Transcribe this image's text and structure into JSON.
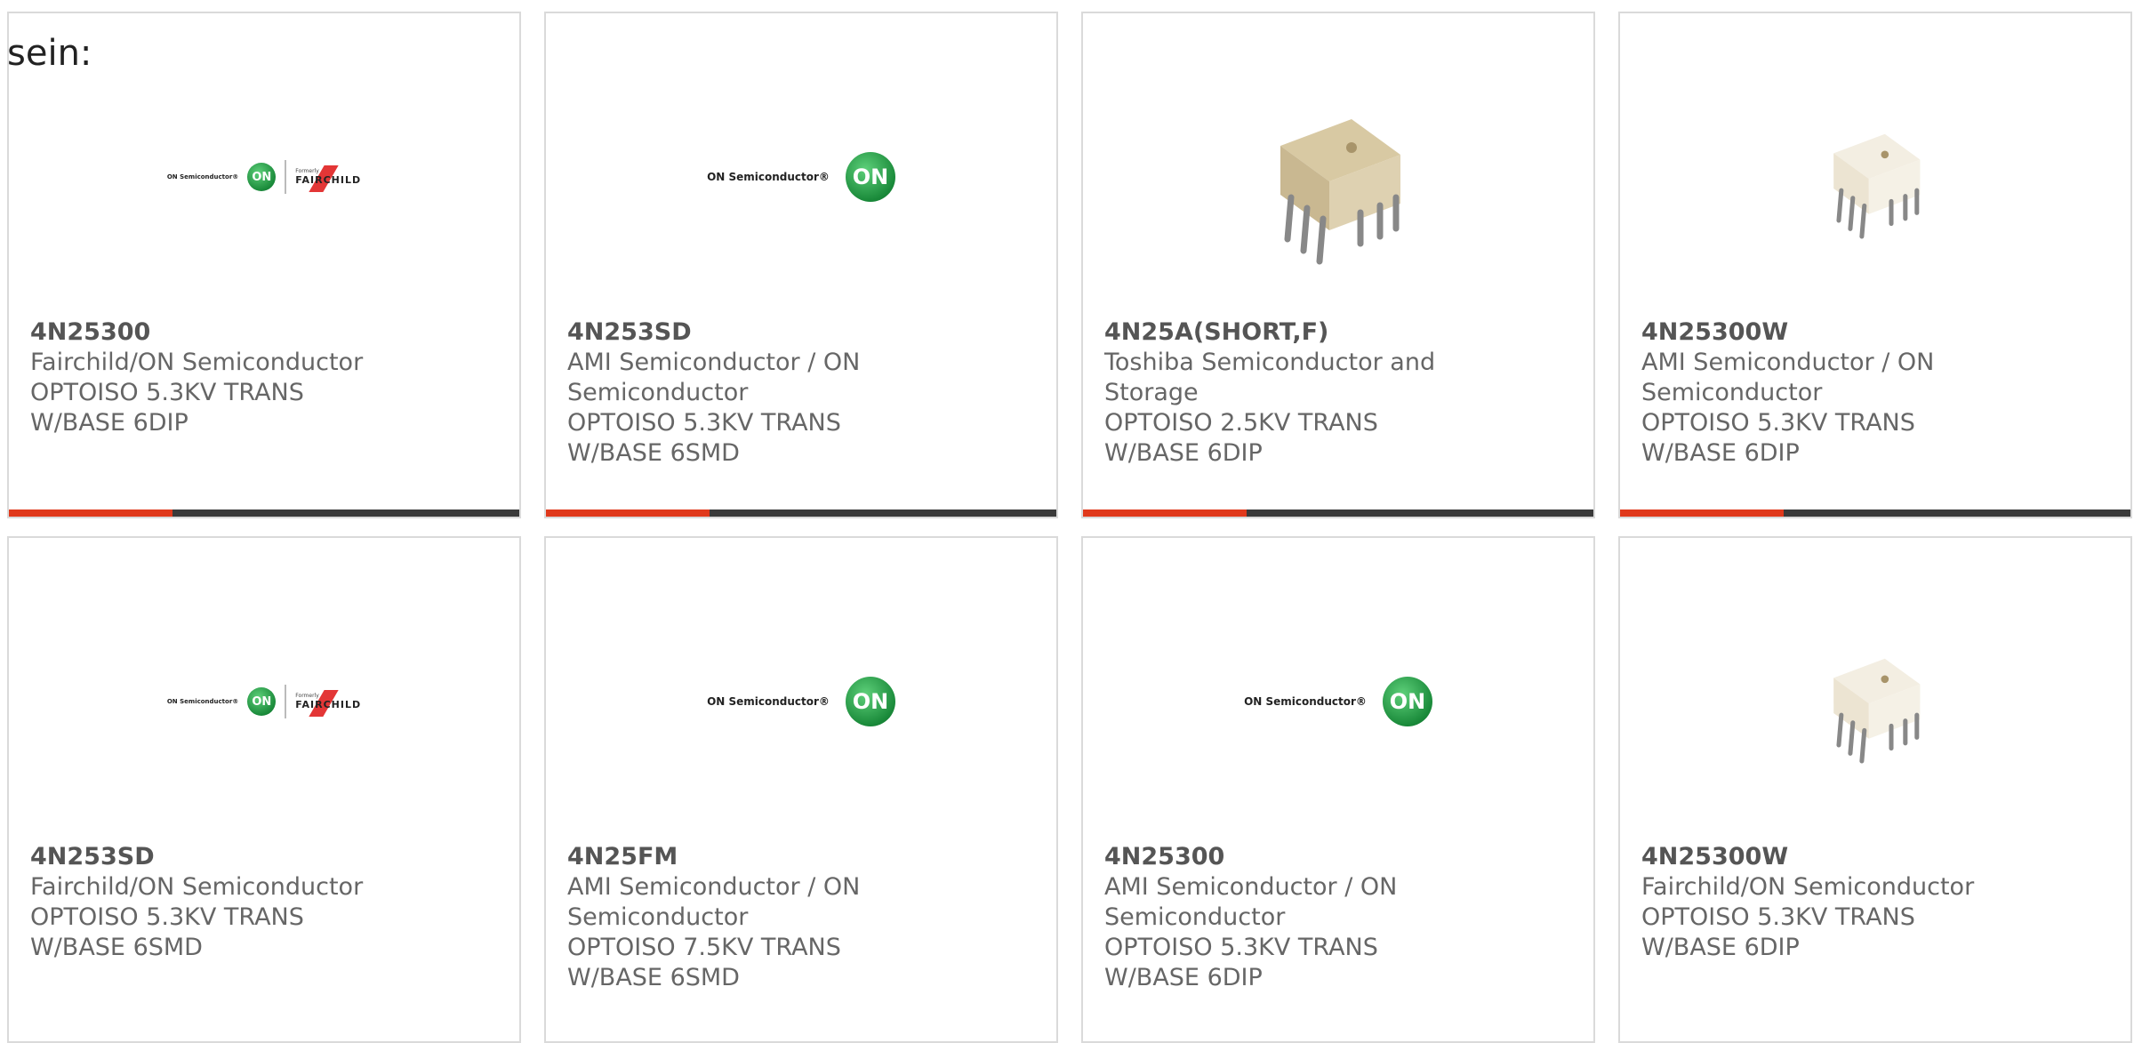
{
  "lead_text": "sein:",
  "colors": {
    "accent": "#e0391c",
    "bar": "#3a3a3a",
    "border": "#dadada",
    "on_green": "#1a8a3a"
  },
  "logo_text": {
    "on_semi": "ON Semiconductor®",
    "on_badge": "ON",
    "formerly": "Formerly",
    "fairchild": "FAIRCHILD"
  },
  "products": [
    {
      "part": "4N25300",
      "manufacturer": "Fairchild/ON Semiconductor",
      "description": "OPTOISO 5.3KV TRANS W/BASE 6DIP",
      "image": "fairchild-on-logo",
      "bar_fraction": 0.32
    },
    {
      "part": "4N253SD",
      "manufacturer": "AMI Semiconductor / ON Semiconductor",
      "description": "OPTOISO 5.3KV TRANS W/BASE 6SMD",
      "image": "on-semi-logo",
      "bar_fraction": 0.32
    },
    {
      "part": "4N25A(SHORT,F)",
      "manufacturer": "Toshiba Semiconductor and Storage",
      "description": "OPTOISO 2.5KV TRANS W/BASE 6DIP",
      "image": "dip-chip-photo-tan",
      "bar_fraction": 0.32
    },
    {
      "part": "4N25300W",
      "manufacturer": "AMI Semiconductor / ON Semiconductor",
      "description": "OPTOISO 5.3KV TRANS W/BASE 6DIP",
      "image": "dip-chip-photo-white",
      "bar_fraction": 0.32
    },
    {
      "part": "4N253SD",
      "manufacturer": "Fairchild/ON Semiconductor",
      "description": "OPTOISO 5.3KV TRANS W/BASE 6SMD",
      "image": "fairchild-on-logo"
    },
    {
      "part": "4N25FM",
      "manufacturer": "AMI Semiconductor / ON Semiconductor",
      "description": "OPTOISO 7.5KV TRANS W/BASE 6SMD",
      "image": "on-semi-logo"
    },
    {
      "part": "4N25300",
      "manufacturer": "AMI Semiconductor / ON Semiconductor",
      "description": "OPTOISO 5.3KV TRANS W/BASE 6DIP",
      "image": "on-semi-logo"
    },
    {
      "part": "4N25300W",
      "manufacturer": "Fairchild/ON Semiconductor",
      "description": "OPTOISO 5.3KV TRANS W/BASE 6DIP",
      "image": "dip-chip-photo-white"
    }
  ]
}
